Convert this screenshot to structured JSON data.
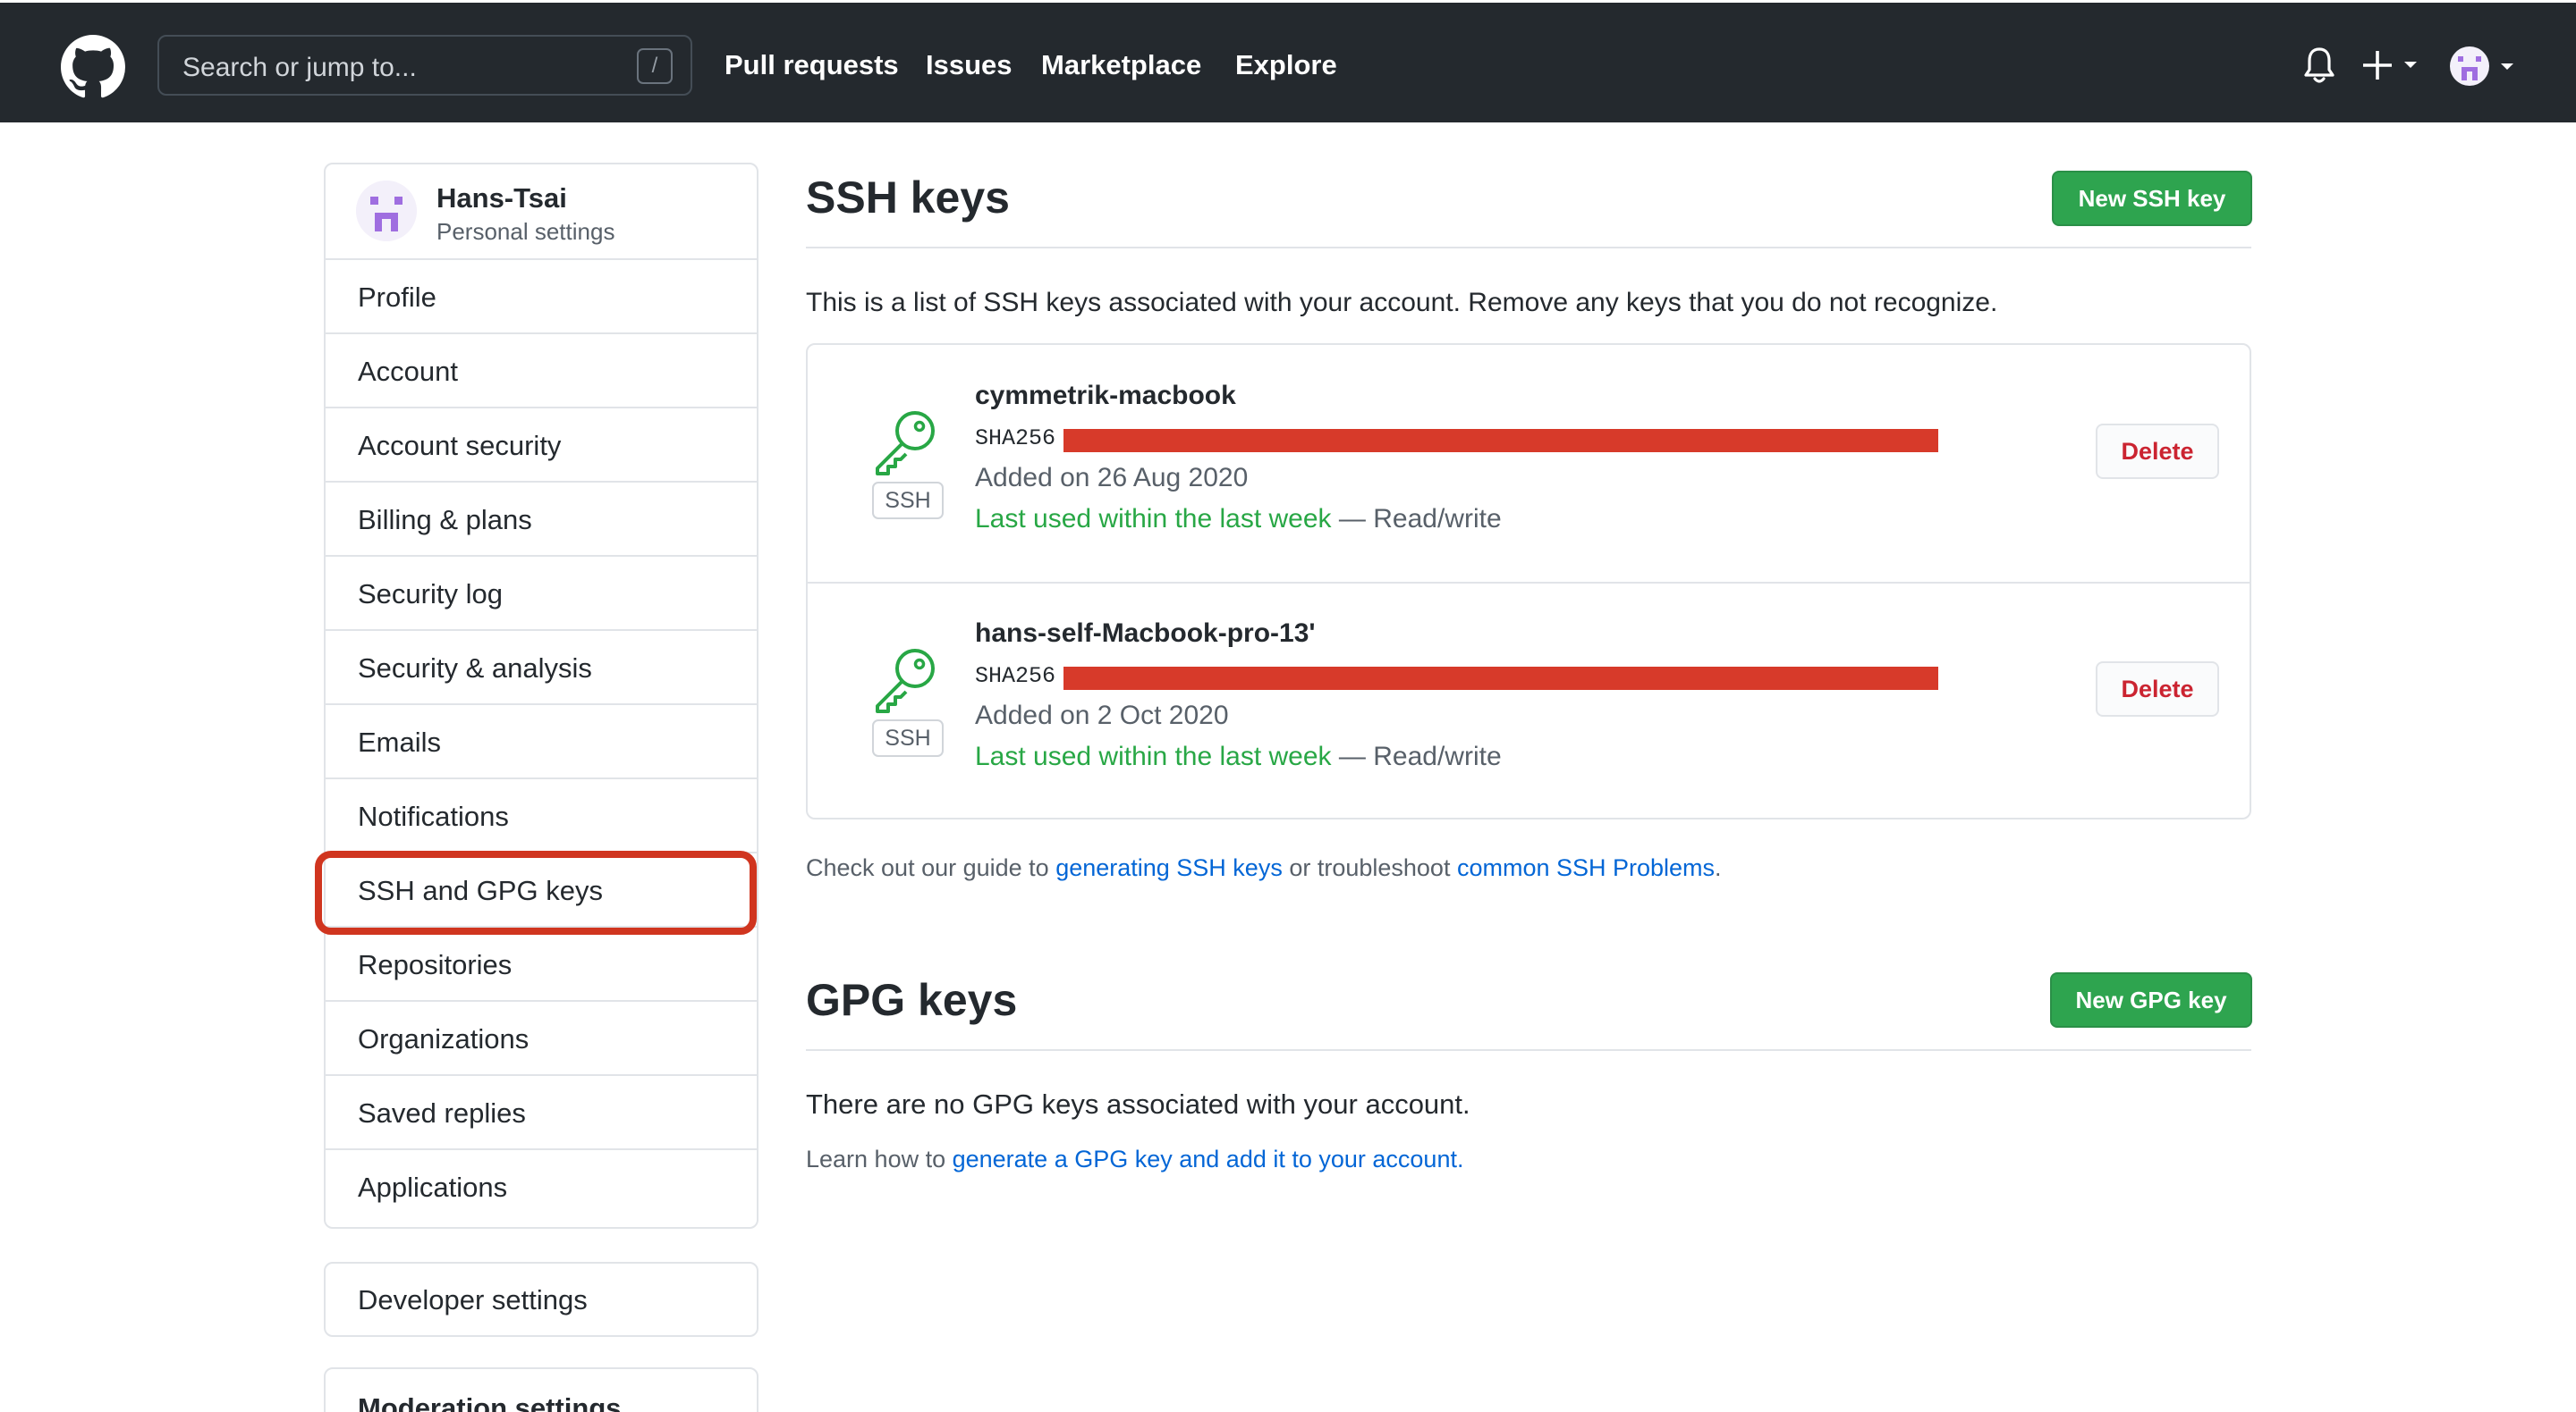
{
  "header": {
    "search_placeholder": "Search or jump to...",
    "search_shortcut": "/",
    "nav": [
      "Pull requests",
      "Issues",
      "Marketplace",
      "Explore"
    ]
  },
  "sidebar": {
    "username": "Hans-Tsai",
    "subtitle": "Personal settings",
    "items": [
      "Profile",
      "Account",
      "Account security",
      "Billing & plans",
      "Security log",
      "Security & analysis",
      "Emails",
      "Notifications",
      "SSH and GPG keys",
      "Repositories",
      "Organizations",
      "Saved replies",
      "Applications"
    ],
    "active_item": "SSH and GPG keys",
    "developer_settings": "Developer settings",
    "moderation_settings": "Moderation settings"
  },
  "ssh": {
    "title": "SSH keys",
    "new_button": "New SSH key",
    "intro": "This is a list of SSH keys associated with your account. Remove any keys that you do not recognize.",
    "keys": [
      {
        "name": "cymmetrik-macbook",
        "fingerprint_label": "SHA256",
        "badge": "SSH",
        "added": "Added on 26 Aug 2020",
        "last_used": "Last used within the last week",
        "access": " — Read/write",
        "delete_label": "Delete"
      },
      {
        "name": "hans-self-Macbook-pro-13'",
        "fingerprint_label": "SHA256",
        "badge": "SSH",
        "added": "Added on 2 Oct 2020",
        "last_used": "Last used within the last week",
        "access": " — Read/write",
        "delete_label": "Delete"
      }
    ],
    "guide_prefix": "Check out our guide to ",
    "guide_link1": "generating SSH keys",
    "guide_middle": " or troubleshoot ",
    "guide_link2": "common SSH Problems",
    "guide_suffix": "."
  },
  "gpg": {
    "title": "GPG keys",
    "new_button": "New GPG key",
    "empty": "There are no GPG keys associated with your account.",
    "learn_prefix": "Learn how to ",
    "learn_link": "generate a GPG key and add it to your account",
    "learn_suffix": "."
  },
  "colors": {
    "header_bg": "#24292e",
    "green": "#2ea44f",
    "danger": "#cb2431",
    "link": "#0366d6",
    "highlight": "#d0351f"
  }
}
